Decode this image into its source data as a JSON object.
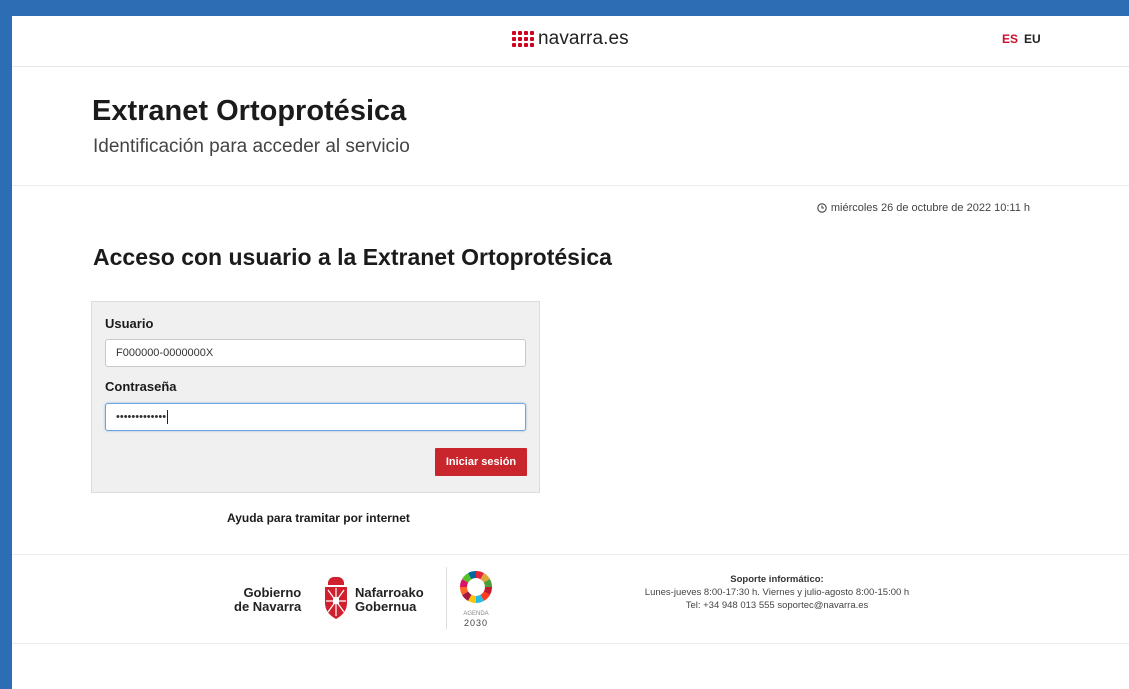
{
  "header": {
    "logo_text": "navarra.es",
    "lang_es": "ES",
    "lang_eu": "EU"
  },
  "hero": {
    "title": "Extranet Ortoprotésica",
    "subtitle": "Identificación para acceder al servicio"
  },
  "datetime": "miércoles 26 de octubre de 2022 10:11 h",
  "section_title": "Acceso con usuario a la Extranet Ortoprotésica",
  "login": {
    "user_label": "Usuario",
    "user_value": "F000000-0000000X",
    "password_label": "Contraseña",
    "password_value": "•••••••••••••",
    "submit_label": "Iniciar sesión"
  },
  "help_link": "Ayuda para tramitar por internet",
  "footer": {
    "gob_es_line1": "Gobierno",
    "gob_es_line2": "de Navarra",
    "gob_eu_line1": "Nafarroako",
    "gob_eu_line2": "Gobernua",
    "agenda_label": "AGENDA",
    "agenda_year": "2030",
    "support_title": "Soporte informático:",
    "support_hours": "Lunes-jueves 8:00-17:30 h. Viernes y julio-agosto 8:00-15:00 h",
    "support_contact": "Tel: +34 948 013 555 soportec@navarra.es"
  },
  "colors": {
    "brand_red": "#c8252c",
    "frame_blue": "#2d6db4"
  }
}
